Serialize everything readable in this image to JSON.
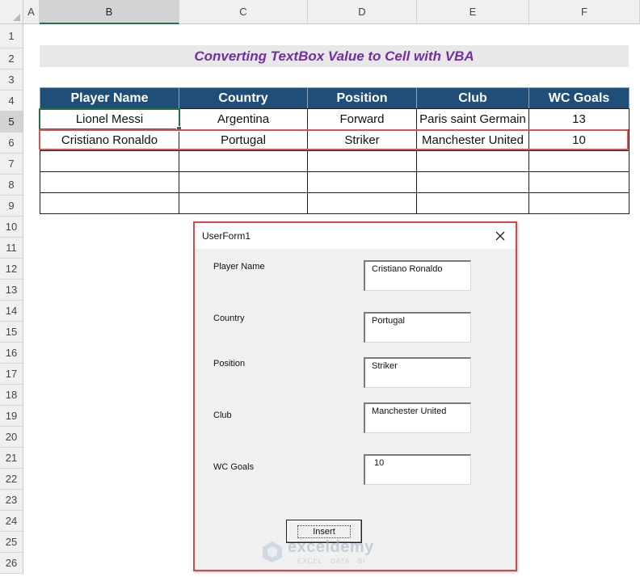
{
  "sheet": {
    "columns": [
      "A",
      "B",
      "C",
      "D",
      "E",
      "F"
    ],
    "rows": [
      "1",
      "2",
      "3",
      "4",
      "5",
      "6",
      "7",
      "8",
      "9",
      "10",
      "11",
      "12",
      "13",
      "14",
      "15",
      "16",
      "17",
      "18",
      "19",
      "20",
      "21",
      "22",
      "23",
      "24",
      "25",
      "26"
    ],
    "title": "Converting TextBox Value to Cell with VBA",
    "title_color": "#7030a0",
    "header_color": "#1f4e78",
    "highlight_color": "#d9534f",
    "table": {
      "headers": [
        "Player Name",
        "Country",
        "Position",
        "Club",
        "WC Goals"
      ],
      "rows": [
        [
          "Lionel Messi",
          "Argentina",
          "Forward",
          "Paris saint Germain",
          "13"
        ],
        [
          "Cristiano Ronaldo",
          "Portugal",
          "Striker",
          "Manchester United",
          "10"
        ],
        [
          "",
          "",
          "",
          "",
          ""
        ],
        [
          "",
          "",
          "",
          "",
          ""
        ],
        [
          "",
          "",
          "",
          "",
          ""
        ]
      ]
    }
  },
  "userform": {
    "title": "UserForm1",
    "close_icon": "close-icon",
    "fields": [
      {
        "label": "Player Name",
        "value": "Cristiano Ronaldo"
      },
      {
        "label": "Country",
        "value": "Portugal"
      },
      {
        "label": "Position",
        "value": "Striker"
      },
      {
        "label": "Club",
        "value": "Manchester United"
      },
      {
        "label": "WC Goals",
        "value": "10"
      }
    ],
    "button_label": "Insert"
  },
  "watermark": {
    "name": "exceldemy",
    "tagline": "EXCEL · DATA · BI"
  }
}
